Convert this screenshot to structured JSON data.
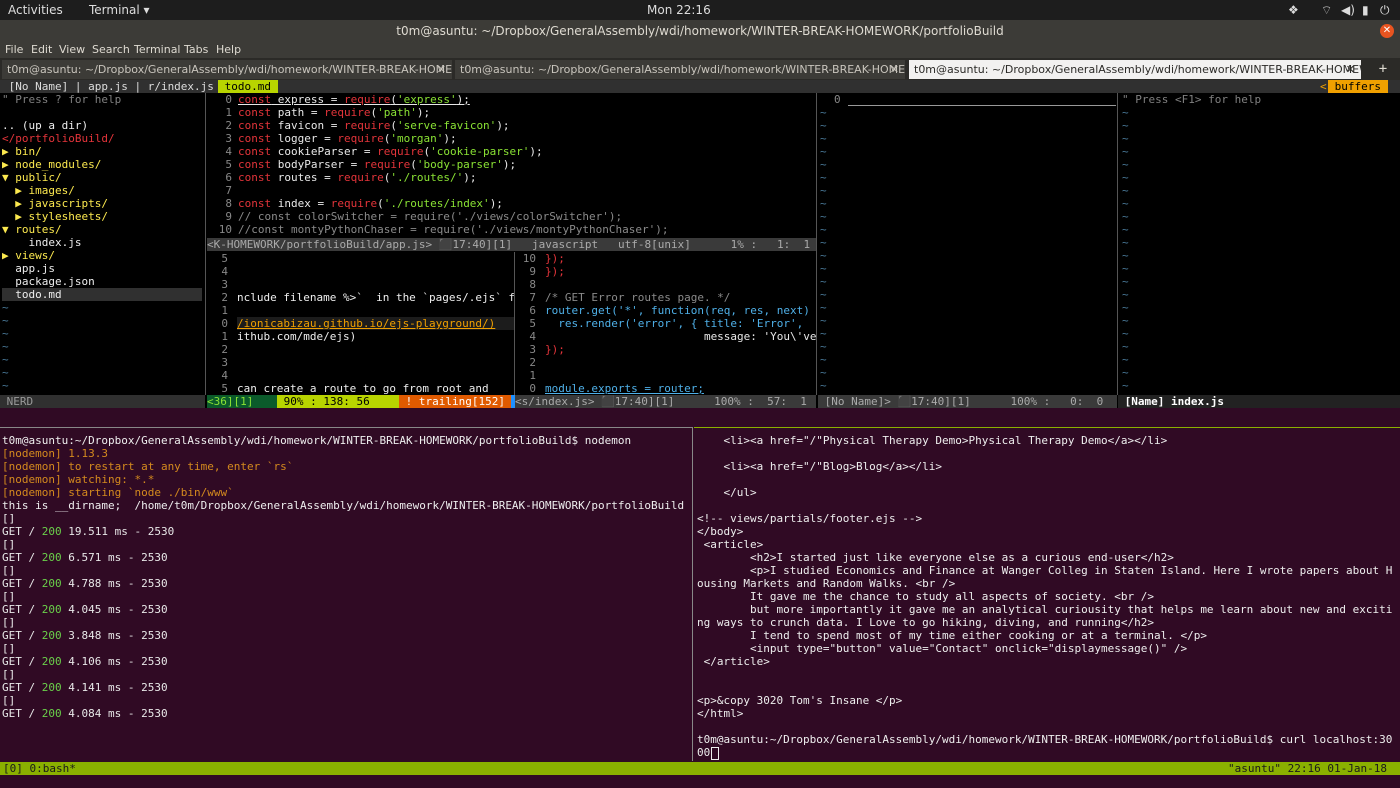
{
  "topbar": {
    "activities": "Activities",
    "app_menu": "Terminal ▾",
    "clock": "Mon 22:16",
    "tray_icons": [
      "dropbox-icon",
      "wifi-icon",
      "volume-icon",
      "battery-icon",
      "power-icon"
    ]
  },
  "window": {
    "title": "t0m@asuntu: ~/Dropbox/GeneralAssembly/wdi/homework/WINTER-BREAK-HOMEWORK/portfolioBuild"
  },
  "menu": [
    "File",
    "Edit",
    "View",
    "Search",
    "Terminal",
    "Tabs",
    "Help"
  ],
  "tabs": [
    {
      "label": "t0m@asuntu: ~/Dropbox/GeneralAssembly/wdi/homework/WINTER-BREAK-HOMEW...",
      "close": "✕"
    },
    {
      "label": "t0m@asuntu: ~/Dropbox/GeneralAssembly/wdi/homework/WINTER-BREAK-HOMEW...",
      "close": "✕"
    },
    {
      "label": "t0m@asuntu: ~/Dropbox/GeneralAssembly/wdi/homework/WINTER-BREAK-HOMEW...",
      "close": "✕"
    }
  ],
  "tab_add": "+",
  "vim": {
    "tabline": {
      "left": " [No Name] | app.js | r/index.js ",
      "active": " todo.md ",
      "right_tag": "<",
      "buffers": " buffers "
    },
    "nerd_help": "\" Press ? for help",
    "nerd_tree": [
      {
        "text": "",
        "cls": "white"
      },
      {
        "text": ".. (up a dir)",
        "cls": "white"
      },
      {
        "text": "</portfolioBuild/",
        "cls": "red"
      },
      {
        "text": "▶ bin/",
        "cls": "yellow"
      },
      {
        "text": "▶ node_modules/",
        "cls": "yellow"
      },
      {
        "text": "▼ public/",
        "cls": "yellow"
      },
      {
        "text": "  ▶ images/",
        "cls": "yellow"
      },
      {
        "text": "  ▶ javascripts/",
        "cls": "yellow"
      },
      {
        "text": "  ▶ stylesheets/",
        "cls": "yellow"
      },
      {
        "text": "▼ routes/",
        "cls": "yellow"
      },
      {
        "text": "    index.js",
        "cls": "white"
      },
      {
        "text": "▶ views/",
        "cls": "yellow"
      },
      {
        "text": "  app.js",
        "cls": "white"
      },
      {
        "text": "  package.json",
        "cls": "white"
      },
      {
        "text": "  todo.md",
        "cls": "white"
      }
    ],
    "nerd_status": " NERD",
    "appjs": [
      {
        "n": "0",
        "t": "const express = require('express');"
      },
      {
        "n": "1",
        "t": "const path = require('path');"
      },
      {
        "n": "2",
        "t": "const favicon = require('serve-favicon');"
      },
      {
        "n": "3",
        "t": "const logger = require('morgan');"
      },
      {
        "n": "4",
        "t": "const cookieParser = require('cookie-parser');"
      },
      {
        "n": "5",
        "t": "const bodyParser = require('body-parser');"
      },
      {
        "n": "6",
        "t": "const routes = require('./routes/');"
      },
      {
        "n": "7",
        "t": ""
      },
      {
        "n": "8",
        "t": "const index = require('./routes/index');"
      },
      {
        "n": "9",
        "t": "// const colorSwitcher = require('./views/colorSwitcher');"
      },
      {
        "n": "10",
        "t": "//const montyPythonChaser = require('./views/montyPythonChaser');"
      }
    ],
    "appjs_status": "<K-HOMEWORK/portfolioBuild/app.js> ⬛17:40][1]   javascript   utf-8[unix]      1% :   1:  1",
    "todo": [
      {
        "n": "5",
        "t": ""
      },
      {
        "n": "4",
        "t": ""
      },
      {
        "n": "3",
        "t": ""
      },
      {
        "n": "2",
        "t": "nclude filename %>`  in the `pages/.ejs` f"
      },
      {
        "n": "1",
        "t": ""
      },
      {
        "n": "0",
        "t": "/ionicabizau.github.io/ejs-playground/)"
      },
      {
        "n": "1",
        "t": "ithub.com/mde/ejs)"
      },
      {
        "n": "2",
        "t": ""
      },
      {
        "n": "3",
        "t": ""
      },
      {
        "n": "4",
        "t": ""
      },
      {
        "n": "5",
        "t": "can create a route to go from root and"
      }
    ],
    "todo_status": {
      "a": "<36][1]  ",
      "b": " 90% : 138: 56 ",
      "c": " ! trailing[152] "
    },
    "indexjs": [
      {
        "n": "10",
        "t": "});"
      },
      {
        "n": "9",
        "t": "});"
      },
      {
        "n": "8",
        "t": ""
      },
      {
        "n": "7",
        "t": "/* GET Error routes page. */"
      },
      {
        "n": "6",
        "t": "router.get('*', function(req, res, next)"
      },
      {
        "n": "5",
        "t": "  res.render('error', { title: 'Error',"
      },
      {
        "n": "4",
        "t": "                        message: 'You\\'ve"
      },
      {
        "n": "3",
        "t": "});"
      },
      {
        "n": "2",
        "t": ""
      },
      {
        "n": "1",
        "t": ""
      },
      {
        "n": "0",
        "t": "module.exports = router;"
      }
    ],
    "indexjs_status": "<s/index.js> ⬛17:40][1]      100% :  57:  1",
    "noname_num": "0",
    "noname_status": " [No Name]> ⬛17:40][1]      100% :   0:  0",
    "help_text": "\" Press <F1> for help",
    "name_status": " [Name] index.js"
  },
  "bash_left": [
    {
      "t": "t0m@asuntu:~/Dropbox/GeneralAssembly/wdi/homework/WINTER-BREAK-HOMEWORK/portfolioBuild$ nodemon",
      "c": "white"
    },
    {
      "t": "[nodemon] 1.13.3",
      "c": "orange"
    },
    {
      "t": "[nodemon] to restart at any time, enter `rs`",
      "c": "orange"
    },
    {
      "t": "[nodemon] watching: *.*",
      "c": "orange"
    },
    {
      "t": "[nodemon] starting `node ./bin/www`",
      "c": "orange"
    },
    {
      "t": "this is __dirname;  /home/t0m/Dropbox/GeneralAssembly/wdi/homework/WINTER-BREAK-HOMEWORK/portfolioBuild",
      "c": "white"
    },
    {
      "t": "[]",
      "c": "white"
    },
    {
      "t": "GET / 200 19.511 ms - 2530",
      "c": "white"
    },
    {
      "t": "[]",
      "c": "white"
    },
    {
      "t": "GET / 200 6.571 ms - 2530",
      "c": "white"
    },
    {
      "t": "[]",
      "c": "white"
    },
    {
      "t": "GET / 200 4.788 ms - 2530",
      "c": "white"
    },
    {
      "t": "[]",
      "c": "white"
    },
    {
      "t": "GET / 200 4.045 ms - 2530",
      "c": "white"
    },
    {
      "t": "[]",
      "c": "white"
    },
    {
      "t": "GET / 200 3.848 ms - 2530",
      "c": "white"
    },
    {
      "t": "[]",
      "c": "white"
    },
    {
      "t": "GET / 200 4.106 ms - 2530",
      "c": "white"
    },
    {
      "t": "[]",
      "c": "white"
    },
    {
      "t": "GET / 200 4.141 ms - 2530",
      "c": "white"
    },
    {
      "t": "[]",
      "c": "white"
    },
    {
      "t": "GET / 200 4.084 ms - 2530",
      "c": "white"
    }
  ],
  "bash_right": [
    "    <li><a href=\"/\"Physical Therapy Demo>Physical Therapy Demo</a></li>",
    "",
    "    <li><a href=\"/\"Blog>Blog</a></li>",
    "",
    "    </ul>",
    "",
    "<!-- views/partials/footer.ejs -->",
    "</body>",
    " <article>",
    "        <h2>I started just like everyone else as a curious end-user</h2>",
    "        <p>I studied Economics and Finance at Wanger Colleg in Staten Island. Here I wrote papers about H",
    "ousing Markets and Random Walks. <br />",
    "        It gave me the chance to study all aspects of society. <br />",
    "        but more importantly it gave me an analytical curiousity that helps me learn about new and exciti",
    "ng ways to crunch data. I Love to go hiking, diving, and running</h2>",
    "        I tend to spend most of my time either cooking or at a terminal. </p>",
    "        <input type=\"button\" value=\"Contact\" onclick=\"displaymessage()\" />",
    " </article>",
    "",
    "",
    "<p>&copy 3020 Tom's Insane </p>",
    "</html>",
    "",
    "t0m@asuntu:~/Dropbox/GeneralAssembly/wdi/homework/WINTER-BREAK-HOMEWORK/portfolioBuild$ curl localhost:30",
    "00"
  ],
  "tmux": {
    "left": "[0] 0:bash*",
    "right": "\"asuntu\" 22:16 01-Jan-18"
  },
  "colors": {
    "terminal_bg": "#300a24",
    "tmux_bar": "#8ab000",
    "vim_tab_active": "#b8d400",
    "buffers": "#f0a000",
    "keyword": "#e3343a",
    "string": "#8ae234"
  }
}
